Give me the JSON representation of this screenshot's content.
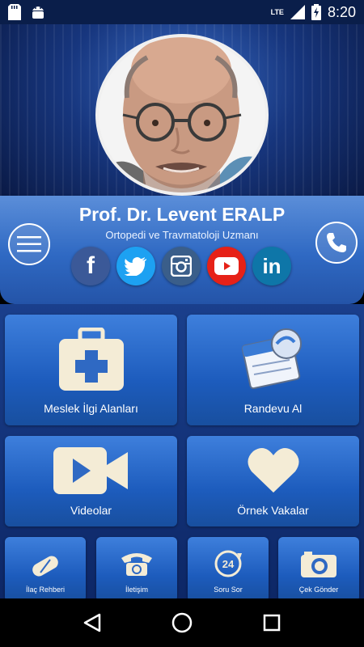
{
  "status_bar": {
    "time": "8:20",
    "network": "LTE",
    "icons": [
      "sd-card-icon",
      "android-icon",
      "signal-icon",
      "battery-charging-icon"
    ]
  },
  "profile": {
    "name": "Prof. Dr. Levent ERALP",
    "specialty": "Ortopedi ve Travmatoloji Uzmanı"
  },
  "header_buttons": {
    "menu_icon": "menu-icon",
    "phone_icon": "phone-icon"
  },
  "social": [
    {
      "name": "facebook",
      "glyph": "f",
      "color": "#3b5998"
    },
    {
      "name": "twitter",
      "glyph": "",
      "color": "#1da1f2"
    },
    {
      "name": "instagram",
      "glyph": "",
      "color": "#3a5e8a"
    },
    {
      "name": "youtube",
      "glyph": "",
      "color": "#e62117"
    },
    {
      "name": "linkedin",
      "glyph": "in",
      "color": "#0e76a8"
    }
  ],
  "tiles": {
    "main": [
      {
        "label": "Meslek İlgi Alanları",
        "icon": "first-aid-kit-icon"
      },
      {
        "label": "Randevu Al",
        "icon": "calendar-icon"
      },
      {
        "label": "Videolar",
        "icon": "video-camera-icon"
      },
      {
        "label": "Örnek Vakalar",
        "icon": "heart-icon"
      }
    ],
    "small": [
      {
        "label": "İlaç Rehberi",
        "icon": "pill-icon"
      },
      {
        "label": "İletişim",
        "icon": "telephone-icon"
      },
      {
        "label": "Soru Sor",
        "icon": "24-hours-icon"
      },
      {
        "label": "Çek Gönder",
        "icon": "camera-icon"
      }
    ]
  },
  "colors": {
    "status_bar": "#0a1e4a",
    "panel": "#2f69c3",
    "tile": "#1d5cbd",
    "youtube": "#e62117"
  }
}
